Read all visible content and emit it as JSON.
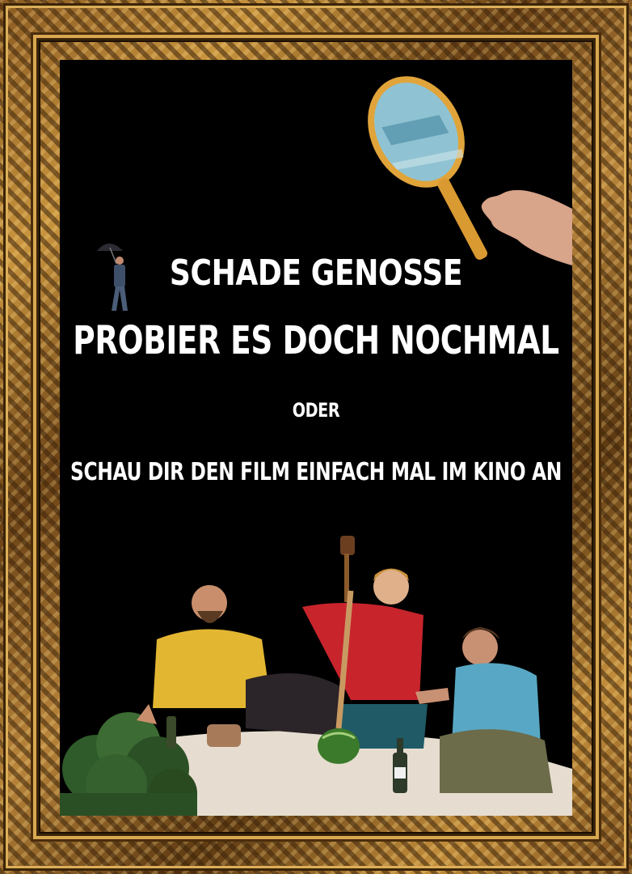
{
  "poster": {
    "line1": "SCHADE GENOSSE",
    "line2": "PROBIER ES DOCH NOCHMAL",
    "line3": "ODER",
    "line4": "SCHAU DIR DEN FILM EINFACH MAL IM KINO AN"
  },
  "colors": {
    "background": "#000000",
    "text": "#ffffff",
    "frame_gold": "#c9953f"
  },
  "illustrations": [
    "hand-mirror",
    "man-with-umbrella",
    "picnic-group",
    "watermelon",
    "wine-bottle",
    "shrub"
  ]
}
